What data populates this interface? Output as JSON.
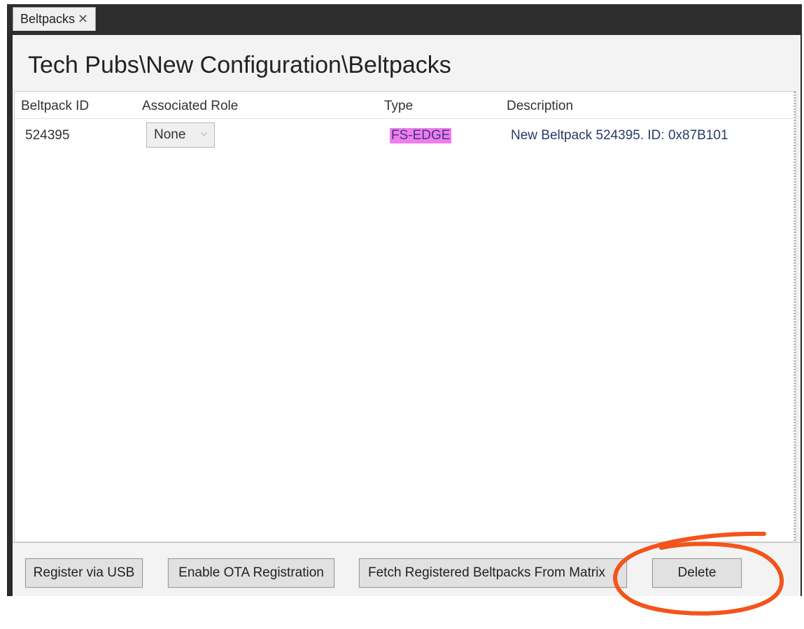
{
  "tab": {
    "label": "Beltpacks",
    "close_glyph": "✕"
  },
  "page": {
    "title": "Tech Pubs\\New Configuration\\Beltpacks"
  },
  "table": {
    "columns": [
      "Beltpack ID",
      "Associated Role",
      "Type",
      "Description"
    ],
    "rows": [
      {
        "id": "524395",
        "role": "None",
        "type": "FS-EDGE",
        "description": "New Beltpack 524395. ID: 0x87B101"
      }
    ]
  },
  "buttons": {
    "register_usb": "Register via USB",
    "enable_ota": "Enable OTA Registration",
    "fetch_registered": "Fetch Registered Beltpacks From Matrix",
    "delete": "Delete"
  },
  "icons": {
    "close": "close-icon",
    "dropdown": "chevron-down-icon"
  },
  "colors": {
    "type_highlight": "#f07cf0",
    "annotation": "#f2541b",
    "tabstrip": "#2d2d2d"
  }
}
